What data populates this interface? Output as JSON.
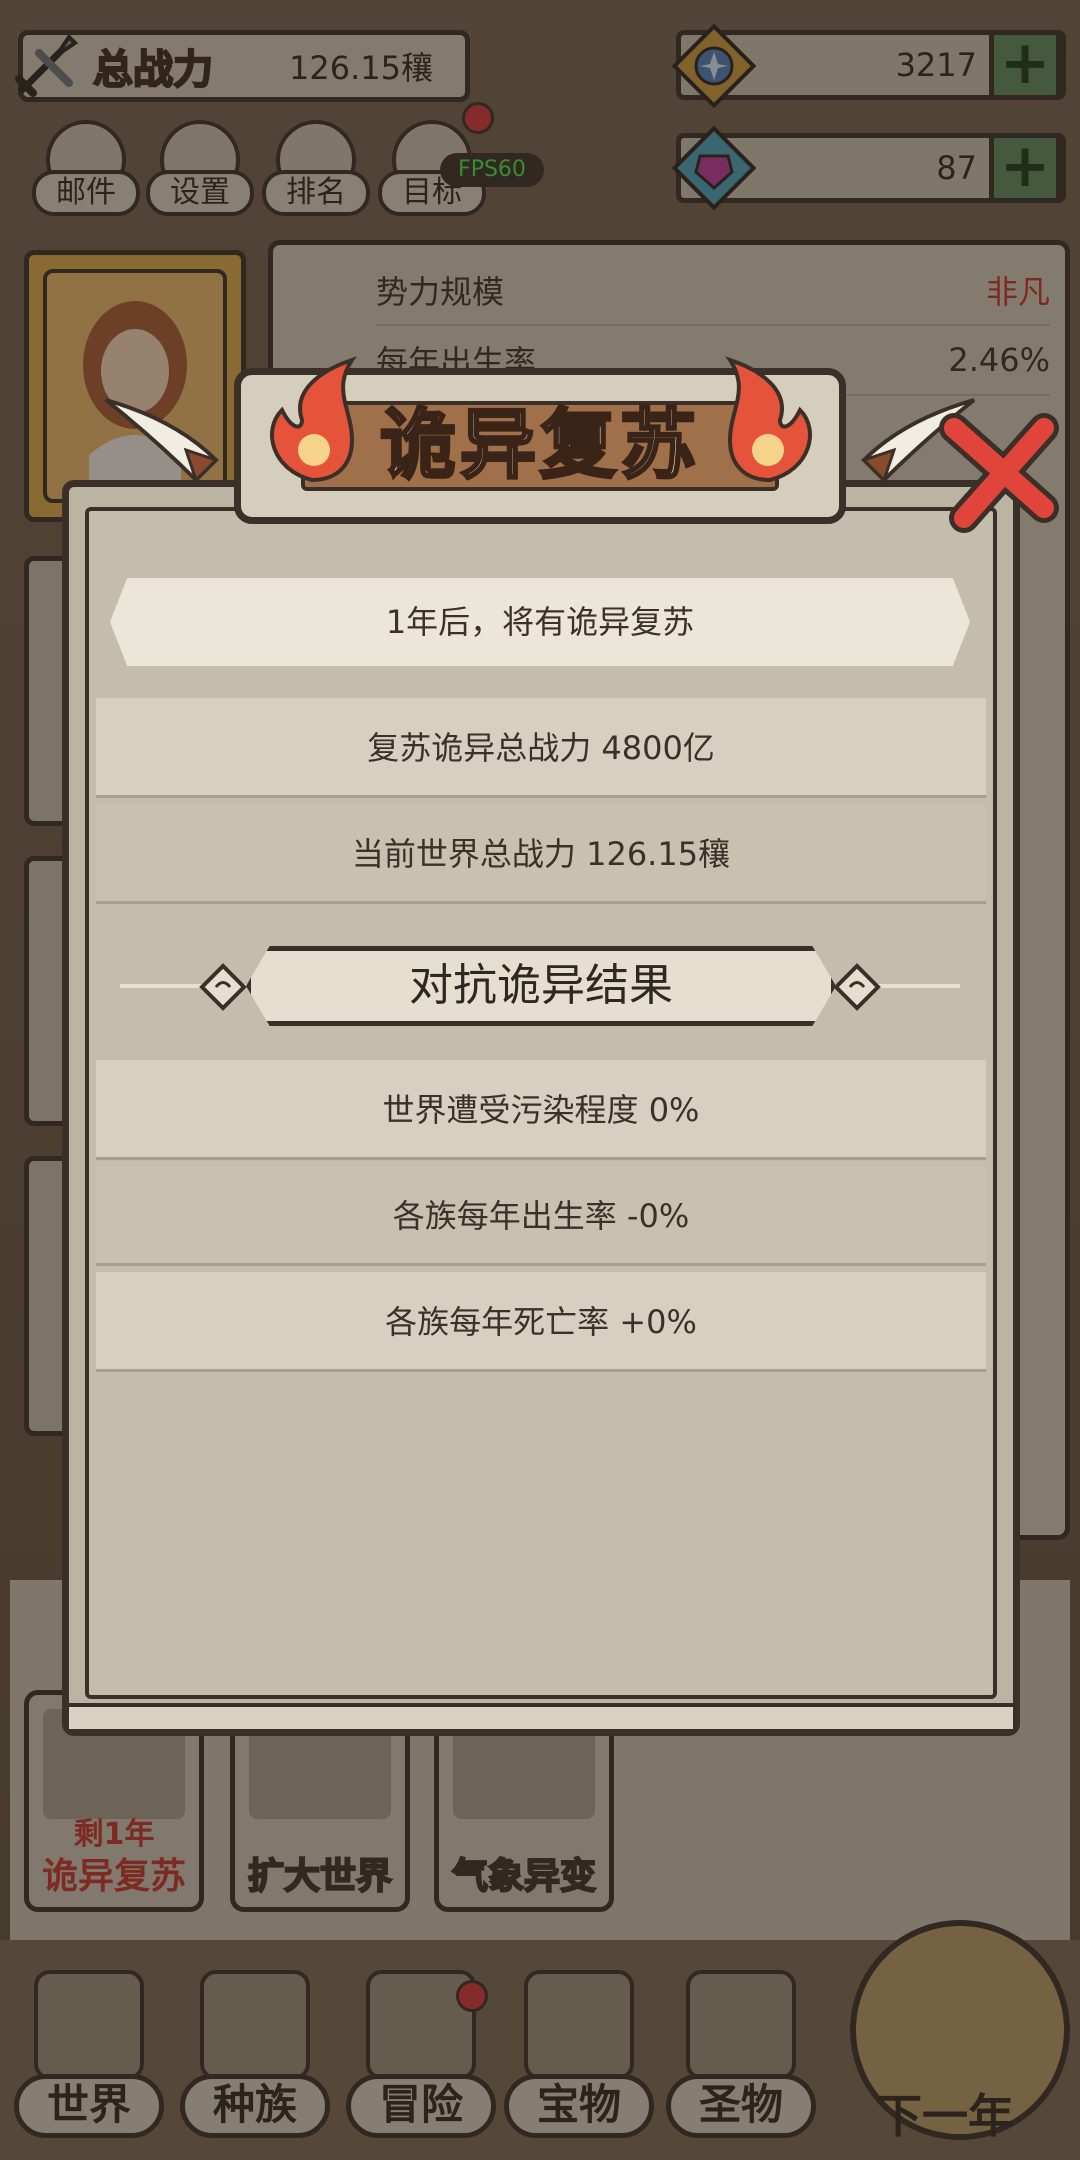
{
  "header": {
    "power_label": "总战力",
    "power_value": "126.15穰",
    "resource1_value": "3217",
    "resource2_value": "87",
    "plus_label": "+"
  },
  "menu": [
    {
      "label": "邮件"
    },
    {
      "label": "设置"
    },
    {
      "label": "排名"
    },
    {
      "label": "目标"
    }
  ],
  "fps": "FPS60",
  "info_panel": {
    "rows": [
      {
        "key": "势力规模",
        "value": "非凡"
      },
      {
        "key": "每年出生率",
        "value": "2.46%"
      }
    ]
  },
  "modal": {
    "title": "诡异复苏",
    "announcement": "1年后，将有诡异复苏",
    "stats": [
      "复苏诡异总战力  4800亿",
      "当前世界总战力  126.15穰"
    ],
    "result_title": "对抗诡异结果",
    "results": [
      "世界遭受污染程度  0%",
      "各族每年出生率  -0%",
      "各族每年死亡率  +0%"
    ]
  },
  "events": [
    {
      "remain": "剩1年",
      "name": "诡异复苏"
    },
    {
      "remain": "",
      "name": "扩大世界"
    },
    {
      "remain": "",
      "name": "气象异变"
    }
  ],
  "nav": [
    {
      "label": "世界"
    },
    {
      "label": "种族"
    },
    {
      "label": "冒险"
    },
    {
      "label": "宝物"
    },
    {
      "label": "圣物"
    }
  ],
  "next_year": "下一年",
  "colors": {
    "accent_red": "#c4342a",
    "plus_green": "#5d8a5a",
    "frame_dark": "#3a3028"
  }
}
